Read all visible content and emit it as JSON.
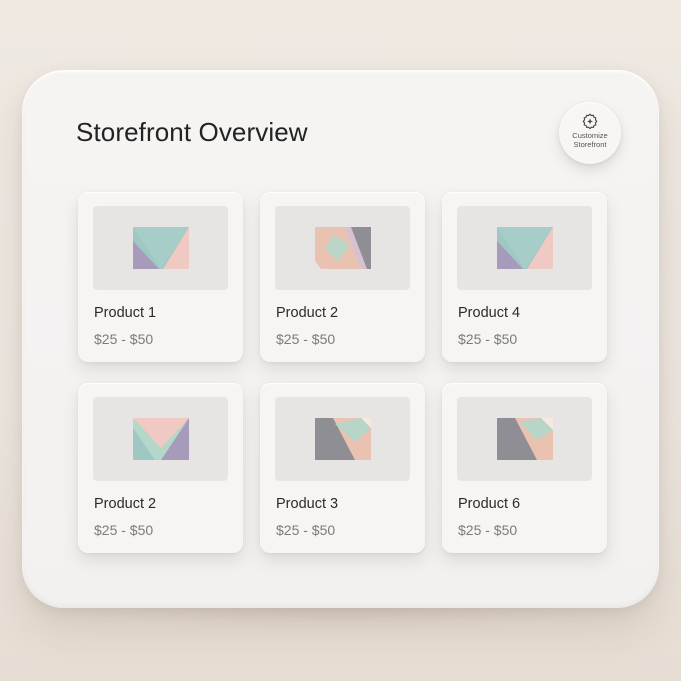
{
  "page": {
    "title": "Storefront Overview"
  },
  "customize_button": {
    "line1": "Customize",
    "line2": "Storefront",
    "icon": "gear-sparkle-icon"
  },
  "products": [
    {
      "name": "Product 1",
      "price": "$25 - $50",
      "image_icon": "abstract-geometric-thumbnail"
    },
    {
      "name": "Product 2",
      "price": "$25 - $50",
      "image_icon": "abstract-geometric-thumbnail"
    },
    {
      "name": "Product 4",
      "price": "$25 - $50",
      "image_icon": "abstract-geometric-thumbnail"
    },
    {
      "name": "Product 2",
      "price": "$25 - $50",
      "image_icon": "abstract-geometric-thumbnail"
    },
    {
      "name": "Product 3",
      "price": "$25 - $50",
      "image_icon": "abstract-geometric-thumbnail"
    },
    {
      "name": "Product 6",
      "price": "$25 - $50",
      "image_icon": "abstract-geometric-thumbnail"
    }
  ],
  "colors": {
    "teal": "#9fc8c4",
    "lavender": "#a79bbb",
    "pink": "#efc9c2",
    "peach": "#e9c2b2",
    "mint": "#b3d8c9",
    "slate": "#8e8e94"
  }
}
